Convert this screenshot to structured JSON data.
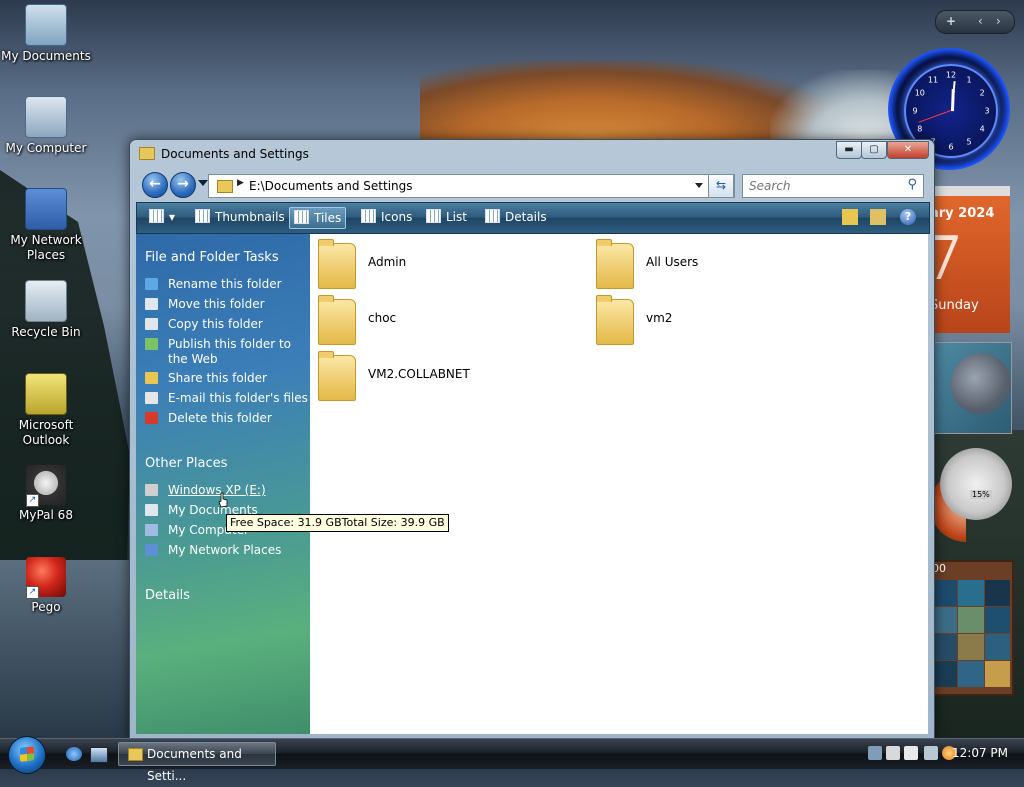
{
  "desktop": {
    "icons": [
      {
        "label": "My Documents",
        "icon": "my-documents-icon"
      },
      {
        "label": "My Computer",
        "icon": "my-computer-icon"
      },
      {
        "label": "My Network Places",
        "icon": "network-icon"
      },
      {
        "label": "Recycle Bin",
        "icon": "recycle-bin-icon"
      },
      {
        "label": "Microsoft Outlook",
        "icon": "outlook-icon"
      },
      {
        "label": "MyPal 68",
        "icon": "mypal-icon"
      },
      {
        "label": "Pego",
        "icon": "pego-icon"
      }
    ]
  },
  "gadgets": {
    "bar_add": "+",
    "bar_prev": "‹",
    "bar_next": "›",
    "clock_numbers": [
      "12",
      "1",
      "2",
      "3",
      "4",
      "5",
      "6",
      "7",
      "8",
      "9",
      "10",
      "11"
    ],
    "calendar_month": "ary 2024",
    "calendar_day": "7",
    "calendar_weekday": "Sunday",
    "meter_percent": "15%",
    "puzzle_time": "00"
  },
  "window": {
    "title": "Documents and Settings",
    "controls": {
      "minimize": "▬",
      "maximize": "▢",
      "close": "✕"
    },
    "address_path": "E:\\Documents and Settings",
    "search_placeholder": "Search",
    "toolbar": {
      "thumbnails": "Thumbnails",
      "tiles": "Tiles",
      "icons": "Icons",
      "list": "List",
      "details": "Details",
      "help": "?"
    },
    "sidebar": {
      "tasks_heading": "File and Folder Tasks",
      "tasks": [
        {
          "label": "Rename this folder",
          "icon": "rename-icon",
          "color": "#5fa8e8"
        },
        {
          "label": "Move this folder",
          "icon": "move-folder-icon",
          "color": "#dfe6ee"
        },
        {
          "label": "Copy this folder",
          "icon": "copy-folder-icon",
          "color": "#dfe6ee"
        },
        {
          "label": "Publish this folder to the Web",
          "icon": "publish-web-icon",
          "color": "#7cc26a"
        },
        {
          "label": "Share this folder",
          "icon": "share-folder-icon",
          "color": "#e8c64f"
        },
        {
          "label": "E-mail this folder's files",
          "icon": "email-icon",
          "color": "#e6e6e6"
        },
        {
          "label": "Delete this folder",
          "icon": "delete-icon",
          "color": "#d63a2c"
        }
      ],
      "places_heading": "Other Places",
      "places": [
        {
          "label": "Windows XP (E:)",
          "icon": "drive-icon",
          "color": "#cfcfcf"
        },
        {
          "label": "My Documents",
          "icon": "my-documents-icon",
          "color": "#dfe6ee"
        },
        {
          "label": "My Computer",
          "icon": "my-computer-icon",
          "color": "#9fbbe0"
        },
        {
          "label": "My Network Places",
          "icon": "network-icon",
          "color": "#5d8ed6"
        }
      ],
      "details_heading": "Details"
    },
    "folders": [
      "Admin",
      "All Users",
      "choc",
      "vm2",
      "VM2.COLLABNET"
    ],
    "tooltip": "Free Space: 31.9 GBTotal Size: 39.9 GB"
  },
  "taskbar": {
    "task_label": "Documents and Setti...",
    "clock": "12:07 PM"
  }
}
